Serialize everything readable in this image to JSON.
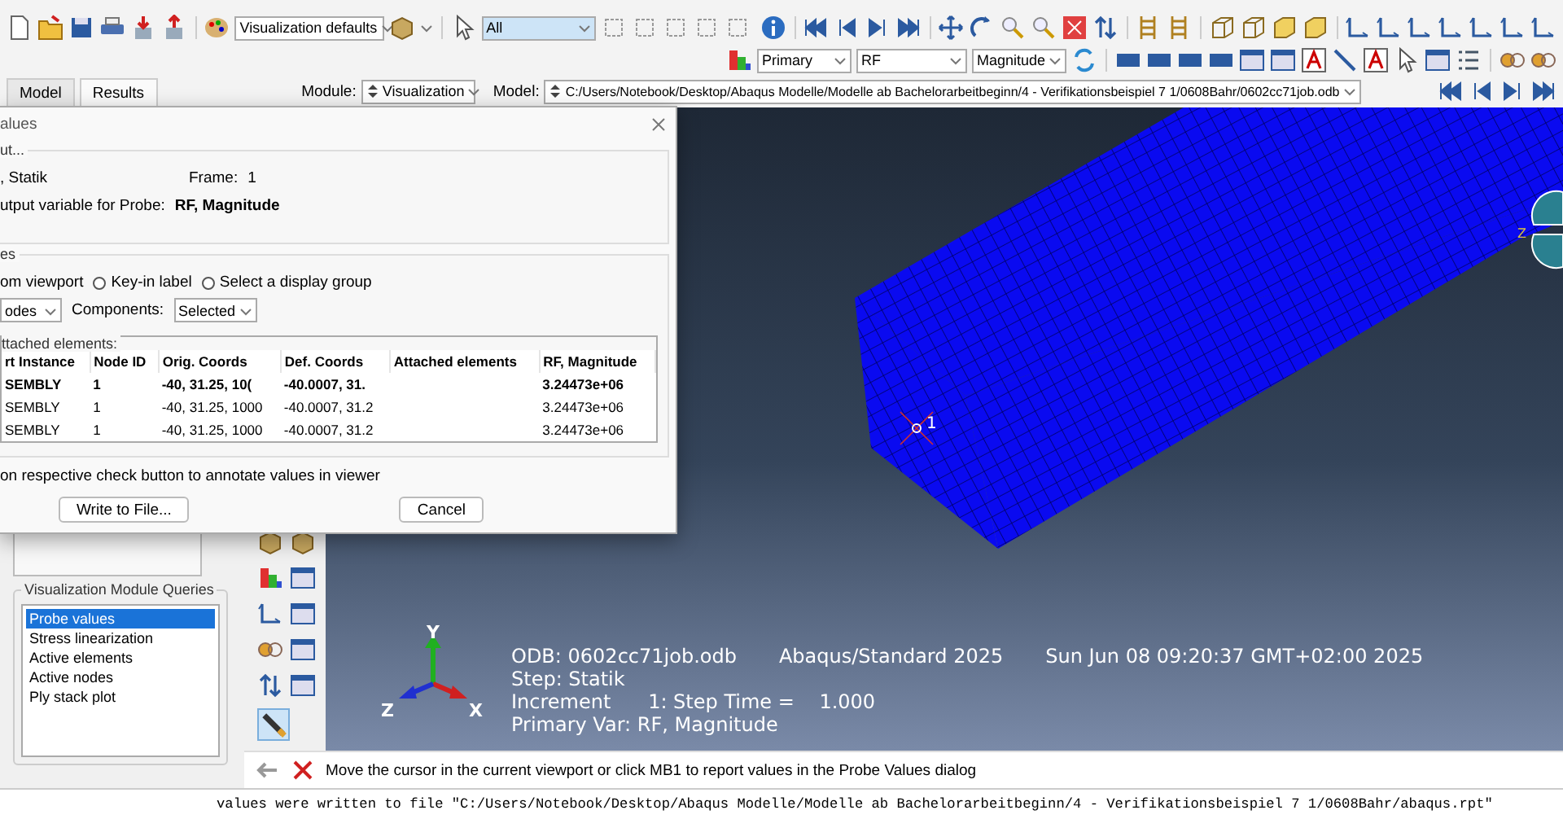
{
  "toolbar_top": {
    "style_combo": "Visualization defaults",
    "selection_combo": "All"
  },
  "toolbar_field": {
    "position_combo": "Primary",
    "variable_combo": "RF",
    "component_combo": "Magnitude"
  },
  "context_bar": {
    "tabs": [
      {
        "label": "Model",
        "selected": false
      },
      {
        "label": "Results",
        "selected": true
      }
    ],
    "module_label": "Module:",
    "module_value": "Visualization",
    "model_label": "Model:",
    "model_value": "C:/Users/Notebook/Desktop/Abaqus Modelle/Modelle ab Bachelorarbeitbeginn/4 - Verifikationsbeispiel 7 1/0608Bahr/0602cc71job.odb"
  },
  "dialog": {
    "title": "alues",
    "output_group": "ut...",
    "step": ", Statik",
    "frame_label": "Frame:",
    "frame_value": "1",
    "variable_label": "utput variable for Probe:",
    "variable_value": "RF, Magnitude",
    "probe_group": "es",
    "cut_option": "om viewport",
    "radio_options": [
      {
        "label": "Key-in label",
        "selected": false
      },
      {
        "label": "Select a display group",
        "selected": false
      }
    ],
    "probe_combo": "odes",
    "components_label": "Components:",
    "components_value": "Selected",
    "table_group": "ttached elements:",
    "table": {
      "columns": [
        "rt Instance",
        "Node ID",
        "Orig. Coords",
        "Def. Coords",
        "Attached elements",
        "RF, Magnitude"
      ],
      "rows": [
        {
          "selected": true,
          "cells": [
            "SEMBLY",
            "1",
            "-40, 31.25, 10(",
            "-40.0007, 31.",
            "",
            "3.24473e+06"
          ]
        },
        {
          "selected": false,
          "cells": [
            "SEMBLY",
            "1",
            "-40, 31.25, 1000",
            "-40.0007, 31.2",
            "",
            "3.24473e+06"
          ]
        },
        {
          "selected": false,
          "cells": [
            "SEMBLY",
            "1",
            "-40, 31.25, 1000",
            "-40.0007, 31.2",
            "",
            "3.24473e+06"
          ]
        }
      ]
    },
    "hint": "on respective check button to annotate values in viewer",
    "buttons": [
      "Write to File...",
      "Cancel"
    ]
  },
  "queries": {
    "title": "Visualization Module Queries",
    "items": [
      {
        "label": "Probe values",
        "selected": true
      },
      {
        "label": "Stress linearization",
        "selected": false
      },
      {
        "label": "Active elements",
        "selected": false
      },
      {
        "label": "Active nodes",
        "selected": false
      },
      {
        "label": "Ply stack plot",
        "selected": false
      }
    ]
  },
  "viewport": {
    "node_label": "1",
    "edge_triad_label": "Z",
    "triad": {
      "x": "X",
      "y": "Y",
      "z": "Z"
    },
    "info": {
      "odb": "ODB: 0602cc71job.odb",
      "solver": "Abaqus/Standard 2025",
      "date": "Sun Jun 08 09:20:37 GMT+02:00 2025",
      "step": "Step: Statik",
      "increment": "Increment      1: Step Time =    1.000",
      "primary": "Primary Var: RF, Magnitude"
    }
  },
  "prompt": "Move the cursor in the current viewport or click MB1 to report values in the Probe Values dialog",
  "message": "values were written to file \"C:/Users/Notebook/Desktop/Abaqus Modelle/Modelle ab Bachelorarbeitbeginn/4 - Verifikationsbeispiel 7 1/0608Bahr/abaqus.rpt\""
}
